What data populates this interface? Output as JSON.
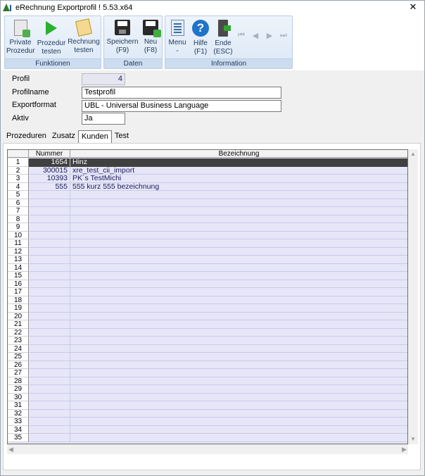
{
  "window": {
    "title": "eRechnung Exportprofil ! 5.53.x64",
    "close_glyph": "✕"
  },
  "ribbon": {
    "groups": [
      {
        "label": "Funktionen",
        "buttons": [
          {
            "line1": "Private",
            "line2": "Prozedur",
            "icon": "document-add-icon"
          },
          {
            "line1": "Prozedur",
            "line2": "testen",
            "icon": "play-icon"
          },
          {
            "line1": "Rechnung",
            "line2": "testen",
            "icon": "paper-icon"
          }
        ]
      },
      {
        "label": "Daten",
        "buttons": [
          {
            "line1": "Speichern",
            "line2": "(F9)",
            "icon": "save-icon"
          },
          {
            "line1": "Neu",
            "line2": "(F8)",
            "icon": "new-icon"
          }
        ]
      },
      {
        "label": "Information",
        "buttons": [
          {
            "line1": "Menu",
            "line2": "-",
            "icon": "menu-icon"
          },
          {
            "line1": "Hilfe",
            "line2": "(F1)",
            "icon": "help-icon"
          },
          {
            "line1": "Ende",
            "line2": "(ESC)",
            "icon": "exit-icon"
          }
        ]
      }
    ],
    "help_glyph": "?",
    "nav": {
      "first": "⏮",
      "prev": "◀",
      "next": "▶",
      "last": "⏭"
    }
  },
  "form": {
    "profil": {
      "label": "Profil",
      "value": "4"
    },
    "profilname": {
      "label": "Profilname",
      "value": "Testprofil"
    },
    "exportformat": {
      "label": "Exportformat",
      "value": "UBL - Universal Business Language"
    },
    "aktiv": {
      "label": "Aktiv",
      "value": "Ja"
    }
  },
  "tabs": [
    {
      "label": "Prozeduren"
    },
    {
      "label": "Zusatz"
    },
    {
      "label": "Kunden",
      "active": true
    },
    {
      "label": "Test"
    }
  ],
  "grid": {
    "columns": [
      "Nummer",
      "Bezeichnung"
    ],
    "rows": [
      {
        "index": "1",
        "nummer": "1654",
        "bezeichnung": "Hinz"
      },
      {
        "index": "2",
        "nummer": "300015",
        "bezeichnung": "xre_test_cii_import"
      },
      {
        "index": "3",
        "nummer": "10393",
        "bezeichnung": "PK´s TestMichi"
      },
      {
        "index": "4",
        "nummer": "555",
        "bezeichnung": "555 kurz 555 bezeichnung"
      },
      {
        "index": "5",
        "nummer": "",
        "bezeichnung": ""
      },
      {
        "index": "6",
        "nummer": "",
        "bezeichnung": ""
      },
      {
        "index": "7",
        "nummer": "",
        "bezeichnung": ""
      },
      {
        "index": "8",
        "nummer": "",
        "bezeichnung": ""
      },
      {
        "index": "9",
        "nummer": "",
        "bezeichnung": ""
      },
      {
        "index": "10",
        "nummer": "",
        "bezeichnung": ""
      },
      {
        "index": "11",
        "nummer": "",
        "bezeichnung": ""
      },
      {
        "index": "12",
        "nummer": "",
        "bezeichnung": ""
      },
      {
        "index": "13",
        "nummer": "",
        "bezeichnung": ""
      },
      {
        "index": "14",
        "nummer": "",
        "bezeichnung": ""
      },
      {
        "index": "15",
        "nummer": "",
        "bezeichnung": ""
      },
      {
        "index": "16",
        "nummer": "",
        "bezeichnung": ""
      },
      {
        "index": "17",
        "nummer": "",
        "bezeichnung": ""
      },
      {
        "index": "18",
        "nummer": "",
        "bezeichnung": ""
      },
      {
        "index": "19",
        "nummer": "",
        "bezeichnung": ""
      },
      {
        "index": "20",
        "nummer": "",
        "bezeichnung": ""
      },
      {
        "index": "21",
        "nummer": "",
        "bezeichnung": ""
      },
      {
        "index": "22",
        "nummer": "",
        "bezeichnung": ""
      },
      {
        "index": "23",
        "nummer": "",
        "bezeichnung": ""
      },
      {
        "index": "24",
        "nummer": "",
        "bezeichnung": ""
      },
      {
        "index": "25",
        "nummer": "",
        "bezeichnung": ""
      },
      {
        "index": "26",
        "nummer": "",
        "bezeichnung": ""
      },
      {
        "index": "27",
        "nummer": "",
        "bezeichnung": ""
      },
      {
        "index": "28",
        "nummer": "",
        "bezeichnung": ""
      },
      {
        "index": "29",
        "nummer": "",
        "bezeichnung": ""
      },
      {
        "index": "30",
        "nummer": "",
        "bezeichnung": ""
      },
      {
        "index": "31",
        "nummer": "",
        "bezeichnung": ""
      },
      {
        "index": "32",
        "nummer": "",
        "bezeichnung": ""
      },
      {
        "index": "33",
        "nummer": "",
        "bezeichnung": ""
      },
      {
        "index": "34",
        "nummer": "",
        "bezeichnung": ""
      },
      {
        "index": "35",
        "nummer": "",
        "bezeichnung": ""
      }
    ],
    "selected_row": 0,
    "scroll": {
      "up": "▲",
      "down": "▼",
      "left": "◀",
      "right": "▶"
    }
  }
}
